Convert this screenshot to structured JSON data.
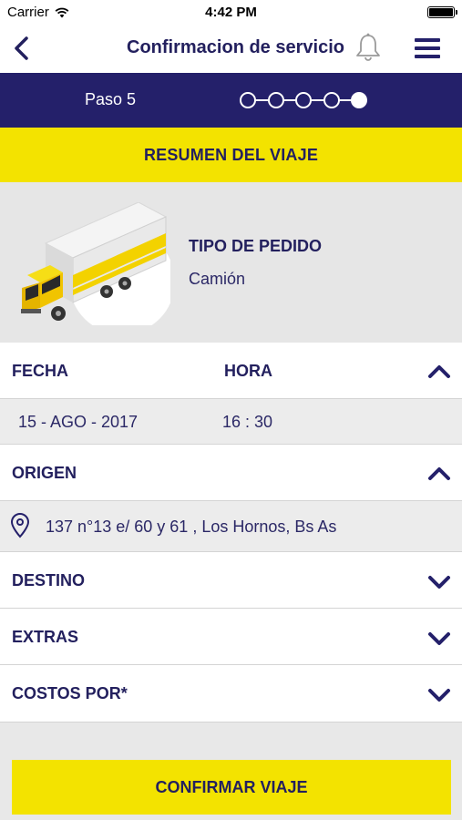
{
  "status_bar": {
    "carrier": "Carrier",
    "time": "4:42 PM"
  },
  "nav": {
    "title": "Confirmacion de servicio"
  },
  "steps": {
    "label": "Paso 5",
    "total": 5,
    "current": 5
  },
  "summary": {
    "title": "RESUMEN DEL VIAJE"
  },
  "order": {
    "label": "TIPO DE PEDIDO",
    "value": "Camión"
  },
  "date_time": {
    "date_label": "FECHA",
    "time_label": "HORA",
    "date_value": "15 - AGO - 2017",
    "time_value": "16 : 30"
  },
  "origin": {
    "label": "ORIGEN",
    "address": "137 n°13 e/ 60 y 61 , Los Hornos, Bs As"
  },
  "destination": {
    "label": "DESTINO"
  },
  "extras": {
    "label": "EXTRAS"
  },
  "costs": {
    "label": "COSTOS POR*"
  },
  "confirm": {
    "label": "CONFIRMAR VIAJE"
  },
  "colors": {
    "navy": "#24206a",
    "yellow": "#f3e300",
    "text": "#23205e"
  }
}
